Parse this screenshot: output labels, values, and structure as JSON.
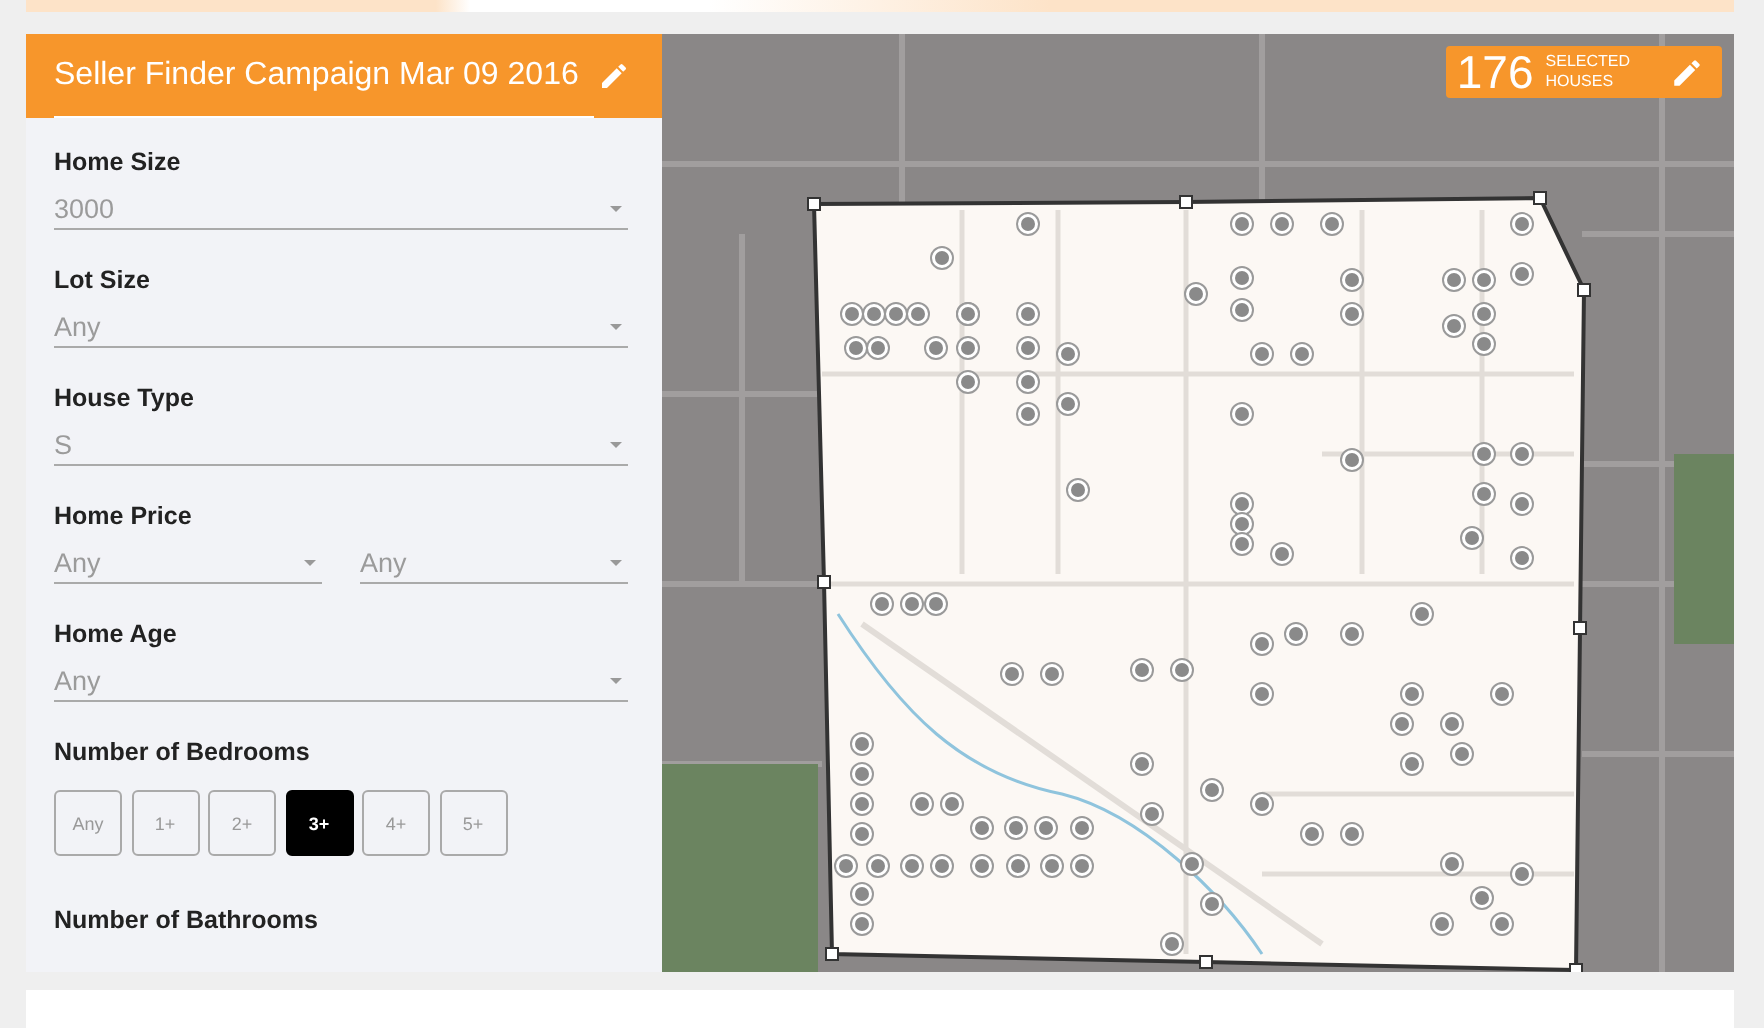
{
  "campaign": {
    "title": "Seller Finder Campaign Mar 09 2016"
  },
  "filters": [
    {
      "kind": "select",
      "label": "Home Size",
      "value": "3000"
    },
    {
      "kind": "select",
      "label": "Lot Size",
      "value": "Any"
    },
    {
      "kind": "select",
      "label": "House Type",
      "value": "S"
    },
    {
      "kind": "range",
      "label": "Home Price",
      "values": [
        "Any",
        "Any"
      ]
    },
    {
      "kind": "select",
      "label": "Home Age",
      "value": "Any"
    },
    {
      "kind": "buttons",
      "label": "Number of Bedrooms",
      "options": [
        {
          "label": "Any",
          "selected": false
        },
        {
          "label": "1+",
          "selected": false
        },
        {
          "label": "2+",
          "selected": false
        },
        {
          "label": "3+",
          "selected": true
        },
        {
          "label": "4+",
          "selected": false
        },
        {
          "label": "5+",
          "selected": false
        }
      ]
    },
    {
      "kind": "buttons",
      "label": "Number of Bathrooms"
    }
  ],
  "selection": {
    "count": "176",
    "caption": [
      "SELECTED",
      "HOUSES"
    ]
  }
}
